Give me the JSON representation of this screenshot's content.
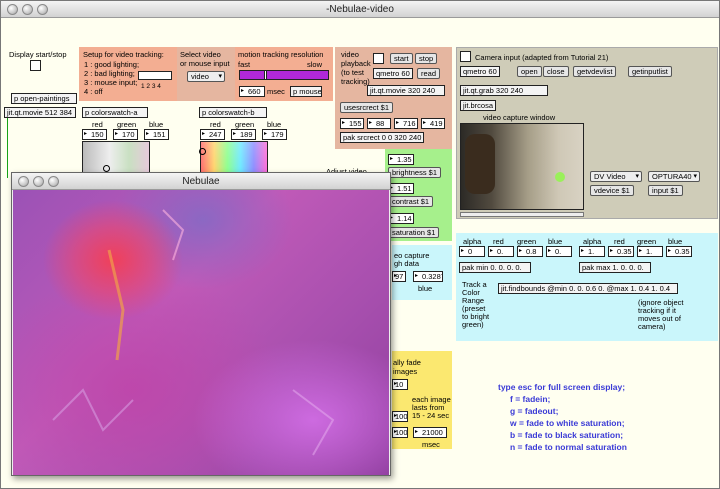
{
  "window": {
    "title": "-Nebulae-video"
  },
  "display": {
    "label": "Display start/stop",
    "open_paintings": "p open-paintings",
    "movie": "jit.qt.movie 512 384"
  },
  "tracking_setup": {
    "title_1": "Setup for video tracking:",
    "opt1": "1 : good lighting;",
    "opt2": "2 : bad lighting;",
    "opt3": "3 : mouse input;",
    "opt4": "4 : off",
    "radio_nums": "1 2 3 4"
  },
  "select_video": {
    "title_1": "Select video",
    "title_2": "or mouse input",
    "menu": "video"
  },
  "motion": {
    "title": "motion tracking resolution",
    "fast": "fast",
    "slow": "slow",
    "value": "660",
    "unit": "msec",
    "mouse": "p mouse"
  },
  "swatch_a": {
    "name": "p colorswatch-a",
    "red_lbl": "red",
    "green_lbl": "green",
    "blue_lbl": "blue",
    "red": "150",
    "green": "170",
    "blue": "151"
  },
  "swatch_b": {
    "name": "p colorswatch-b",
    "red_lbl": "red",
    "green_lbl": "green",
    "blue_lbl": "blue",
    "red": "247",
    "green": "189",
    "blue": "179"
  },
  "playback": {
    "title_1": "video",
    "title_2": "playback",
    "title_3": "(to test",
    "title_4": "tracking)",
    "start": "start",
    "stop": "stop",
    "metro": "qmetro 60",
    "read": "read",
    "movie": "jit.qt.movie 320 240",
    "usesrcrect": "usesrcrect $1",
    "n1": "155",
    "n2": "88",
    "n3": "716",
    "n4": "419",
    "pak": "pak srcrect 0 0 320 240"
  },
  "camera": {
    "title": "Camera input (adapted from Tutorial 21)",
    "metro": "qmetro 60",
    "open": "open",
    "close": "close",
    "getvdevlist": "getvdevlist",
    "getinputlist": "getinputlist",
    "grab": "jit.qt.grab 320 240",
    "brcosa": "jit.brcosa",
    "caption": "video capture window",
    "dv_menu": "DV Video",
    "optura_menu": "OPTURA40",
    "vdevice": "vdevice $1",
    "input": "input $1"
  },
  "adjust": {
    "title": "Adjust video",
    "brightness_val": "1.35",
    "brightness": "brightness $1",
    "contrast_val": "1.51",
    "contrast": "contrast $1",
    "saturation_val": "1.14",
    "saturation": "saturation $1"
  },
  "capture": {
    "line1": "eo capture",
    "line2": "gh data",
    "val": "97",
    "val2": "0.3287",
    "blue": "blue"
  },
  "color_range": {
    "alpha1": "alpha",
    "red1": "red",
    "green1": "green",
    "blue1": "blue",
    "a1": "0",
    "r1": "0.",
    "g1": "0.8",
    "b1": "0.",
    "alpha2": "alpha",
    "red2": "red",
    "green2": "green",
    "blue2": "blue",
    "a2": "1.",
    "r2": "0.35",
    "g2": "1.",
    "b2": "0.35",
    "pak_min": "pak min 0. 0. 0. 0.",
    "pak_max": "pak max 1. 0. 0. 0.",
    "track_1": "Track a",
    "track_2": "Color",
    "track_3": "Range",
    "track_4": "(preset",
    "track_5": "to bright",
    "track_6": "green)",
    "findbounds": "jit.findbounds @min 0. 0. 0.6 0. @max 1. 0.4 1. 0.4",
    "ignore_1": "(ignore object",
    "ignore_2": "tracking if it",
    "ignore_3": "moves out of",
    "ignore_4": "camera)"
  },
  "fade": {
    "line1": "ally fade",
    "line2": "images",
    "n1": "10",
    "n2": "1000",
    "n3": "1000",
    "n4": "21000",
    "each_1": "each image",
    "each_2": "lasts from",
    "each_3": "15 - 24 sec",
    "msec": "msec"
  },
  "help": {
    "l1": "type esc for full screen display;",
    "l2": "f = fadein;",
    "l3": "g = fadeout;",
    "l4": "w = fade to white saturation;",
    "l5": "b = fade to black saturation;",
    "l6": "n = fade to normal saturation"
  },
  "nebulae": {
    "title": "Nebulae"
  },
  "colors": {
    "help_text": "#3a3ad6",
    "slider": "#b028d8"
  }
}
